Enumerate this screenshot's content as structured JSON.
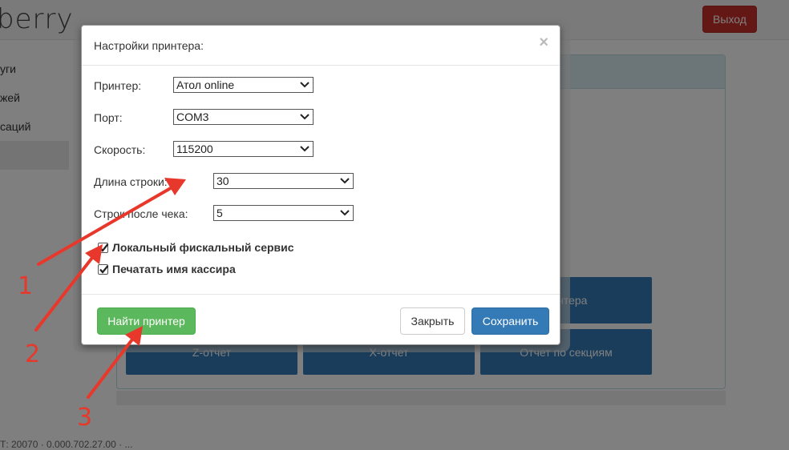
{
  "app": {
    "brand_text": "berry",
    "logout_label": "Выход"
  },
  "sidebar": {
    "items": [
      {
        "label": "уги"
      },
      {
        "label": "жей"
      },
      {
        "label": "саций"
      },
      {
        "label": ""
      }
    ]
  },
  "main": {
    "buttons": {
      "printer_partial": "ринтера",
      "z_report": "Z-отчет",
      "x_report": "X-отчет",
      "section_report": "Отчет по секциям"
    },
    "footer_text": "Т: 20070 · 0.000.702.27.00 · ..."
  },
  "modal": {
    "title": "Настройки принтера:",
    "close_glyph": "×",
    "fields": {
      "printer": {
        "label": "Принтер:",
        "value": "Атол online"
      },
      "port": {
        "label": "Порт:",
        "value": "COM3"
      },
      "speed": {
        "label": "Скорость:",
        "value": "115200"
      },
      "line_length": {
        "label": "Длина строки:",
        "value": "30"
      },
      "lines_after": {
        "label": "Строк после чека:",
        "value": "5"
      }
    },
    "checkboxes": {
      "local_fiscal": {
        "label": "Локальный фискальный сервис",
        "checked": true
      },
      "print_cashier": {
        "label": "Печатать имя кассира",
        "checked": true
      }
    },
    "buttons": {
      "find_printer": "Найти принтер",
      "close": "Закрыть",
      "save": "Сохранить"
    }
  },
  "annotations": {
    "numbers": [
      "1",
      "2",
      "3"
    ],
    "color": "#e8372b"
  }
}
